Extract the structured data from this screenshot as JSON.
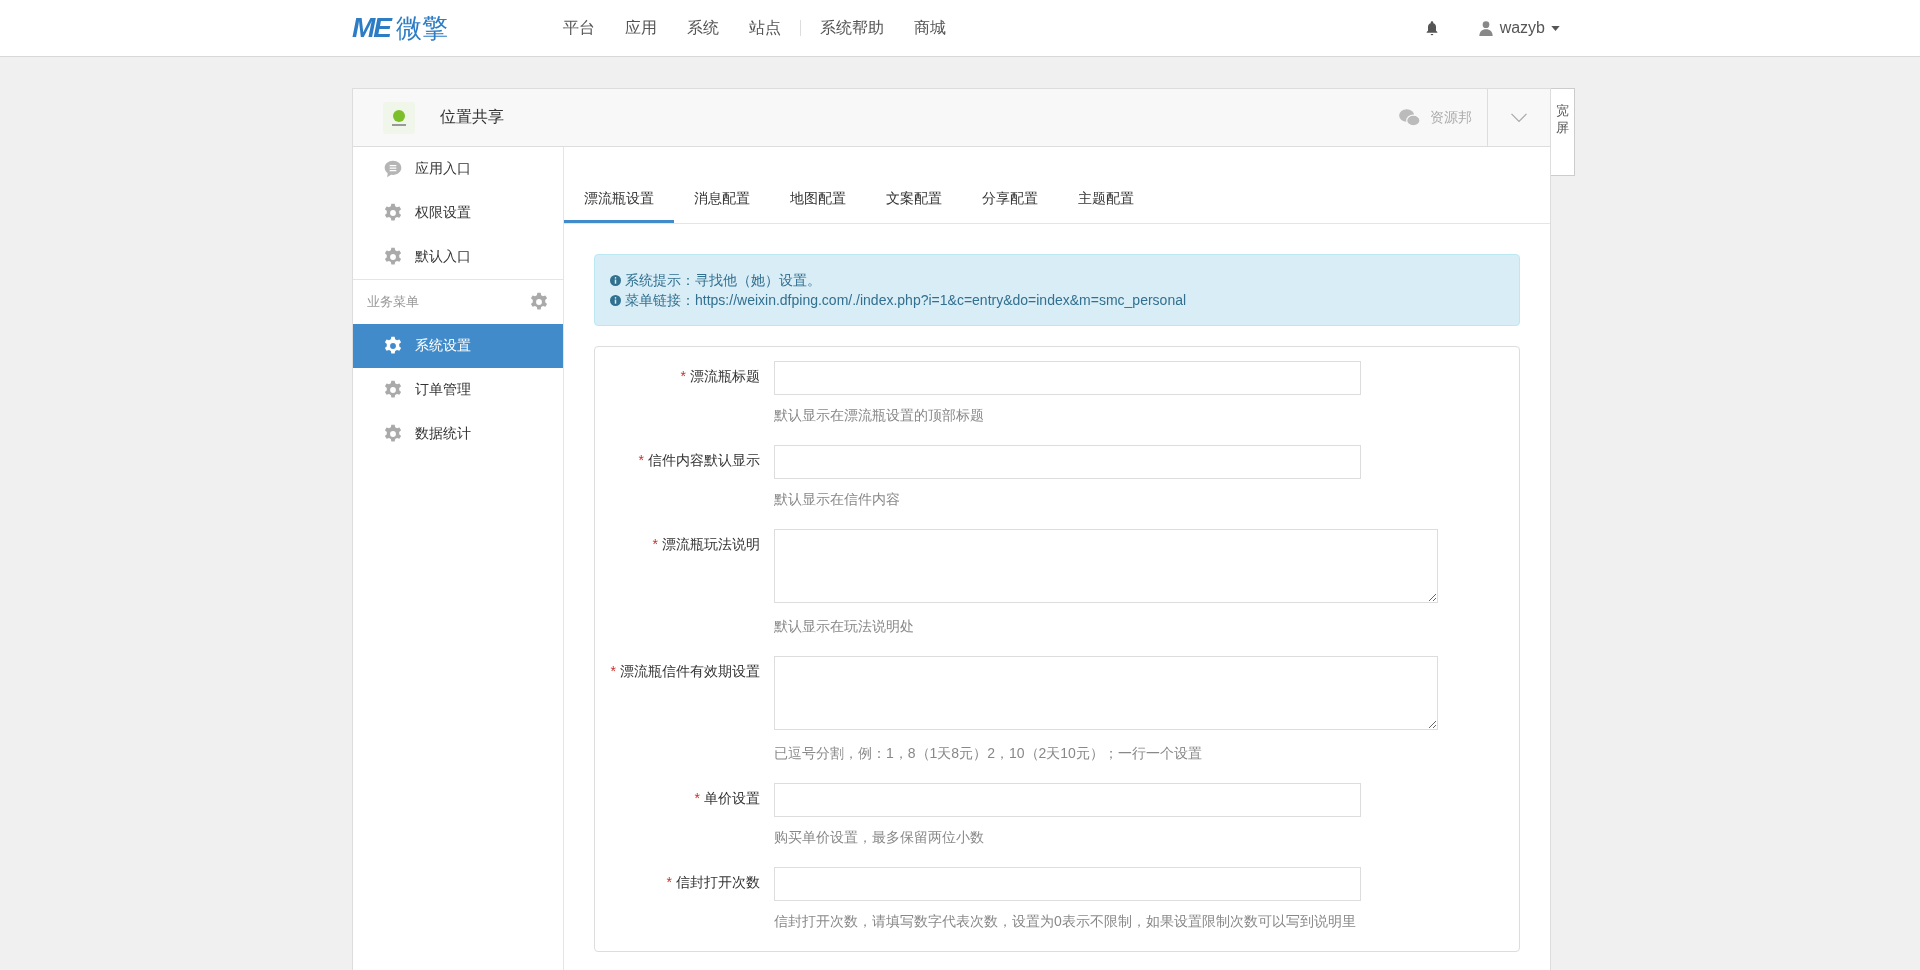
{
  "topbar": {
    "logo_mark": "ME",
    "logo_text": "微擎",
    "nav": [
      {
        "label": "平台",
        "divider_before": false
      },
      {
        "label": "应用",
        "divider_before": false
      },
      {
        "label": "系统",
        "divider_before": false
      },
      {
        "label": "站点",
        "divider_before": false
      },
      {
        "label": "系统帮助",
        "divider_before": true
      },
      {
        "label": "商城",
        "divider_before": false
      }
    ],
    "user": "wazyb"
  },
  "panel": {
    "app_name": "位置共享",
    "account": "资源邦",
    "wide_button": "宽屏"
  },
  "sidebar": {
    "items": [
      {
        "label": "应用入口",
        "kind": "chat",
        "selected": false
      },
      {
        "label": "权限设置",
        "kind": "gear",
        "selected": false
      },
      {
        "label": "默认入口",
        "kind": "gear",
        "selected": false
      }
    ],
    "section_title": "业务菜单",
    "section_items": [
      {
        "label": "系统设置",
        "kind": "gear",
        "selected": true
      },
      {
        "label": "订单管理",
        "kind": "gear",
        "selected": false
      },
      {
        "label": "数据统计",
        "kind": "gear",
        "selected": false
      }
    ]
  },
  "tabs": [
    {
      "label": "漂流瓶设置",
      "selected": true
    },
    {
      "label": "消息配置",
      "selected": false
    },
    {
      "label": "地图配置",
      "selected": false
    },
    {
      "label": "文案配置",
      "selected": false
    },
    {
      "label": "分享配置",
      "selected": false
    },
    {
      "label": "主题配置",
      "selected": false
    }
  ],
  "notice": [
    "系统提示：寻找他（她）设置。",
    "菜单链接：https://weixin.dfping.com/./index.php?i=1&c=entry&do=index&m=smc_personal"
  ],
  "form": [
    {
      "label": "漂流瓶标题",
      "required_mark": "*",
      "kind": "input",
      "help": "默认显示在漂流瓶设置的顶部标题"
    },
    {
      "label": "信件内容默认显示",
      "required_mark": "*",
      "kind": "input",
      "help": "默认显示在信件内容"
    },
    {
      "label": "漂流瓶玩法说明",
      "required_mark": "*",
      "kind": "textarea",
      "help": "默认显示在玩法说明处"
    },
    {
      "label": "漂流瓶信件有效期设置",
      "required_mark": "*",
      "kind": "textarea",
      "help": "已逗号分割，例：1，8（1天8元）2，10（2天10元）；一行一个设置"
    },
    {
      "label": "单价设置",
      "required_mark": "*",
      "kind": "input",
      "help": "购买单价设置，最多保留两位小数"
    },
    {
      "label": "信封打开次数",
      "required_mark": "*",
      "kind": "input",
      "help": "信封打开次数，请填写数字代表次数，设置为0表示不限制，如果设置限制次数可以写到说明里"
    }
  ]
}
